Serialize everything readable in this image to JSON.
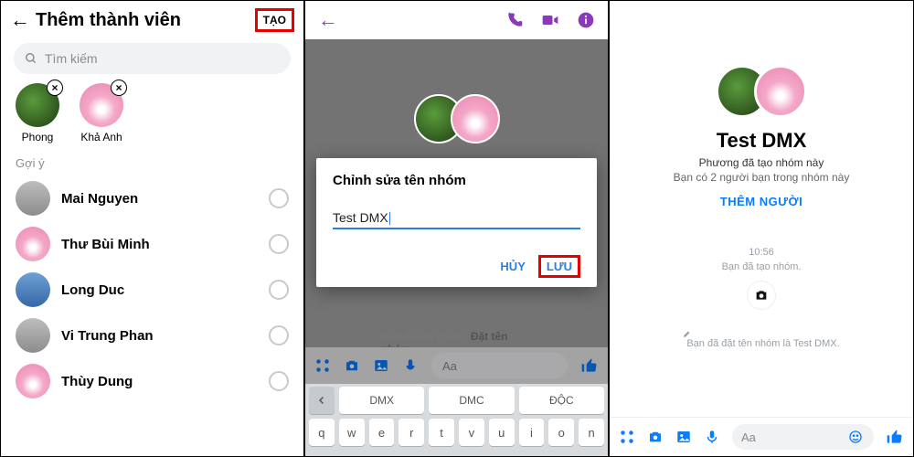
{
  "panel1": {
    "title": "Thêm thành viên",
    "create": "TẠO",
    "search_placeholder": "Tìm kiếm",
    "selected": [
      {
        "name": "Phong"
      },
      {
        "name": "Khả Anh"
      }
    ],
    "suggestions_label": "Gợi ý",
    "suggestions": [
      {
        "name": "Mai Nguyen"
      },
      {
        "name": "Thư Bùi Minh"
      },
      {
        "name": "Long Duc"
      },
      {
        "name": "Vi Trung Phan"
      },
      {
        "name": "Thùy Dung"
      }
    ]
  },
  "panel2": {
    "dialog_title": "Chỉnh sửa tên nhóm",
    "input_value": "Test DMX",
    "cancel": "HỦY",
    "save": "LƯU",
    "bg_note_a": "Bạn đã tạo nhóm.",
    "bg_note_b": "Đặt tên nhóm",
    "composer_placeholder": "Aa",
    "keyboard_row1": [
      "DMX",
      "DMC",
      "ĐỘC"
    ],
    "keyboard_row2": [
      "q",
      "w",
      "e",
      "r",
      "t",
      "v",
      "u",
      "i",
      "o",
      "n"
    ]
  },
  "panel3": {
    "group_name": "Test DMX",
    "created_by": "Phương đã tạo nhóm này",
    "friends_line": "Bạn có 2 người bạn trong nhóm này",
    "add_people": "THÊM NGƯỜI",
    "time": "10:56",
    "made_line": "Bạn đã tạo nhóm.",
    "named_line": "Bạn đã đặt tên nhóm là Test DMX.",
    "composer_placeholder": "Aa"
  }
}
